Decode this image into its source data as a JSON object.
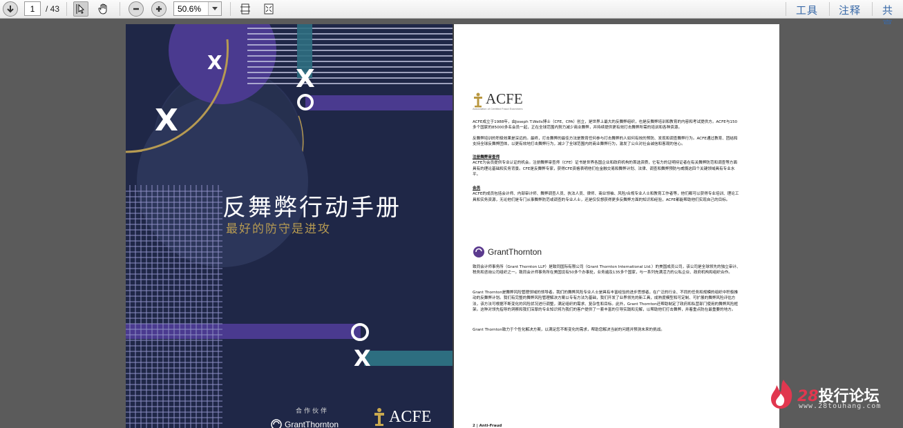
{
  "toolbar": {
    "page_current": "1",
    "page_total": "/ 43",
    "zoom": "50.6%",
    "links": [
      "工具",
      "注释",
      "共享"
    ]
  },
  "cover": {
    "title": "反舞弊行动手册",
    "subtitle": "最好的防守是进攻",
    "marks": [
      "X",
      "X",
      "X",
      "X"
    ],
    "partner_label": "合作伙伴",
    "grant_thornton": "GrantThornton",
    "acfe": "ACFE",
    "colors": {
      "bg": "#1f2747",
      "purple": "#4a3a8f",
      "teal": "#2d6e80",
      "gold": "#b69a52"
    }
  },
  "page2": {
    "acfe_logo": "ACFE",
    "acfe_tagline": "Association of Certified Fraud Examiners",
    "acfe_intro": "ACFE成立于1988年，由Joseph T.Wells博士（CFE、CPA）创立，是世界上最大的反舞弊组织，也是反舞弊培训和教育的内容和考试提供方。ACFE与150多个国家的85000多名会员一起，正在全球范围内努力减少商业舞弊，并持续提供更有效打击舞弊所需的培训和各种资源。",
    "acfe_mission": "反舞弊培训的积极效果是深远的。最终，打击舞弊的最佳方法是教育任何参与打击舞弊的人如何有效的预防、发现和调查舞弊行为。ACFE通过教育、团结和支持全球反舞弊团体，以更有效地打击舞弊行为，减少了全球范围内的商业舞弊行为，激发了公众对社会诚信和客观的信心。",
    "cfe_heading": "注册舞弊审查师",
    "cfe_text": "ACFE为会员提供专业认证的机会。注册舞弊审查师（CFE）证书是世界各国企业和政府机构的首选资质，它有力的证明持证者在有关舞弊防范和调查等方面具有的理论基础和实务背景。CFE是反舞弊专家，获得CFE资格表明他们在金融交易和舞弊计划、法律、调查和舞弊预防与威慑这四个关键领域具有专业水平。",
    "member_heading": "会员",
    "member_text": "ACFE的成员包括会计师、内部审计师、舞弊调查人员、执法人员、律师、商业领袖、风险/合规专业人士和教育工作者等，他们都可以获得专业培训、理论工具和实务资源，无论他们是专门从事舞弊防范或调查的专业人士，还是仅仅想获得更多反舞弊方面的知识和经验，ACFE都能帮助他们实现自己的目标。",
    "gt_logo": "GrantThornton",
    "gt_intro": "致同会计师事务所（Grant Thornton LLP）是致同国际有限公司（Grant Thornton International Ltd.）的美国成员公司，该公司是全球领先的独立审计、税务和咨询公司组织之一。致同会计师事务所在美国设有50多个办事处，业务遍及135多个国家，与一系列充满活力的公私企业、政府机构和组织合作。",
    "gt_services": "Grant Thornton是舞弊风险管理领域的领导者。我们的舞弊风险专业人士是具有丰富经验的进步思想者，在广泛的行业、不同的任务和规模的组织中积极推动的反舞弊计划。我们有完整的舞弊风险管理解决方案以专有方法为基础，我们开发了业界领先的新工具，成熟度模型和可定制、可扩展的舞弊风险评估方法，该方法可根据不断变化的风险状况进行调整，满足组织的需求、复杂性和目标。此外，Grant Thornton还帮助制定了政府和私营部门使用的舞弊风险框架。这种对领先指导的洞察和我们深厚的专业知识将为我们的客户提供了一套丰富的引导实践和见解，以帮助他们打击舞弊，并着重点防在最重要的地方。",
    "gt_closing": "Grant Thornton致力于个性化解决方案，以满足您不断变化的需求，帮助您解决当前的问题并预测未来的挑战。",
    "footer": "2 | Anti-Fraud"
  },
  "watermark": {
    "brand_num": "28",
    "brand_text": "投行论坛",
    "url": "www.28touhang.com"
  }
}
